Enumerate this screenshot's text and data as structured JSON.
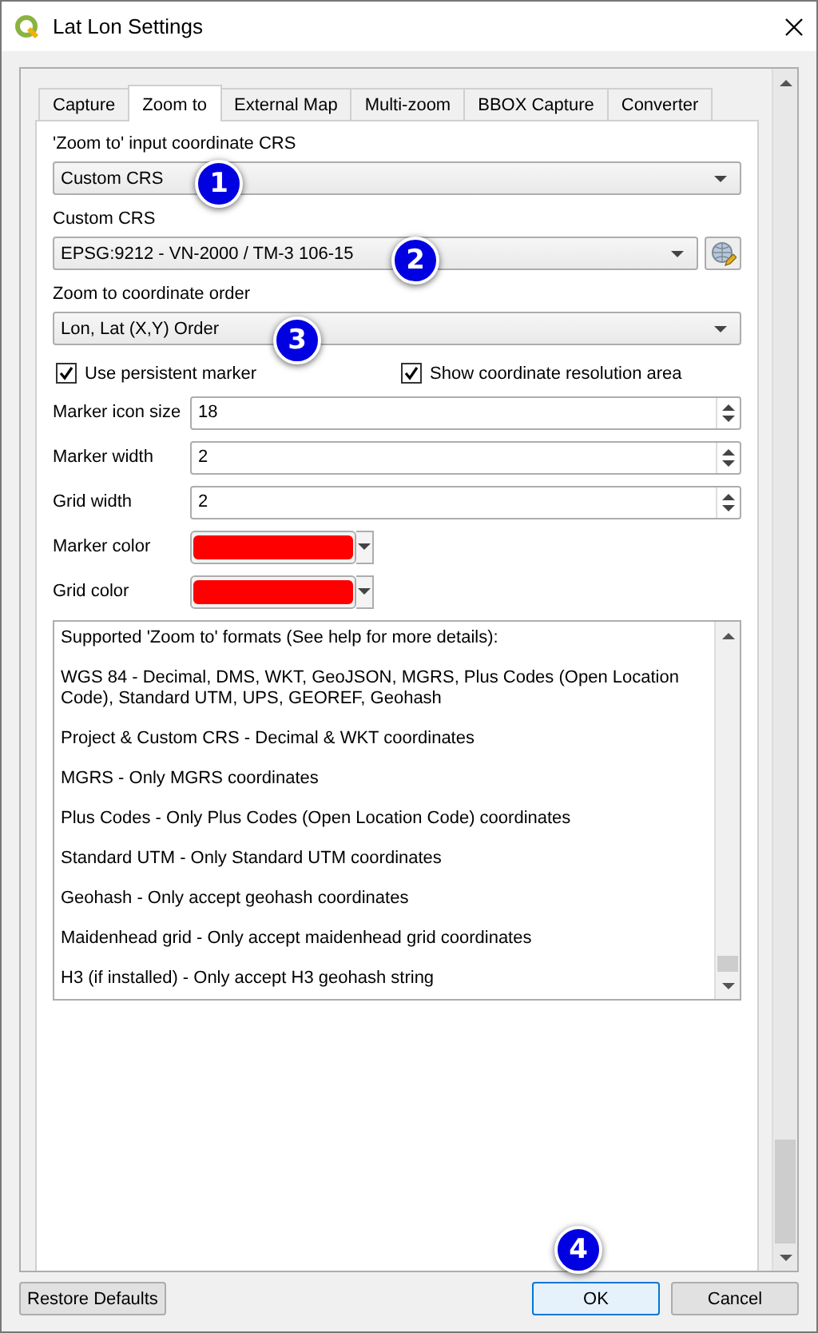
{
  "window": {
    "title": "Lat Lon Settings"
  },
  "tabs": [
    {
      "label": "Capture",
      "selected": false
    },
    {
      "label": "Zoom to",
      "selected": true
    },
    {
      "label": "External Map",
      "selected": false
    },
    {
      "label": "Multi-zoom",
      "selected": false
    },
    {
      "label": "BBOX Capture",
      "selected": false
    },
    {
      "label": "Converter",
      "selected": false
    }
  ],
  "dropdowns": [
    {
      "label": "'Zoom to' input coordinate CRS",
      "value": "Custom CRS",
      "kind": "plain"
    },
    {
      "label": "Custom CRS",
      "value": "EPSG:9212 - VN-2000 / TM-3 106-15",
      "kind": "crs"
    },
    {
      "label": "Zoom to coordinate order",
      "value": "Lon, Lat (X,Y) Order",
      "kind": "plain"
    }
  ],
  "checkboxes": [
    {
      "label": "Use persistent marker",
      "checked": true
    },
    {
      "label": "Show coordinate resolution area",
      "checked": true
    }
  ],
  "spin_rows": [
    {
      "label": "Marker icon size",
      "value": "18"
    },
    {
      "label": "Marker width",
      "value": "2"
    },
    {
      "label": "Grid width",
      "value": "2"
    }
  ],
  "color_rows": [
    {
      "label": "Marker color",
      "color": "#ff0000"
    },
    {
      "label": "Grid color",
      "color": "#ff0000"
    }
  ],
  "help_text": {
    "paragraphs": [
      "Supported 'Zoom to' formats (See help for more details):",
      "WGS 84 - Decimal, DMS, WKT, GeoJSON, MGRS, Plus Codes (Open Location Code), Standard UTM, UPS, GEOREF, Geohash",
      "Project & Custom CRS - Decimal & WKT coordinates",
      "MGRS - Only MGRS coordinates",
      "Plus Codes - Only Plus Codes (Open Location Code) coordinates",
      "Standard UTM - Only Standard UTM coordinates",
      "Geohash - Only accept geohash coordinates",
      "Maidenhead grid - Only accept maidenhead grid coordinates",
      "H3 (if installed) - Only accept H3 geohash string"
    ]
  },
  "buttons": [
    {
      "label": "Restore Defaults",
      "kind": "left"
    },
    {
      "label": "OK",
      "kind": "default"
    },
    {
      "label": "Cancel",
      "kind": "normal"
    }
  ],
  "callouts": [
    {
      "label": "1"
    },
    {
      "label": "2"
    },
    {
      "label": "3"
    },
    {
      "label": "4"
    }
  ]
}
